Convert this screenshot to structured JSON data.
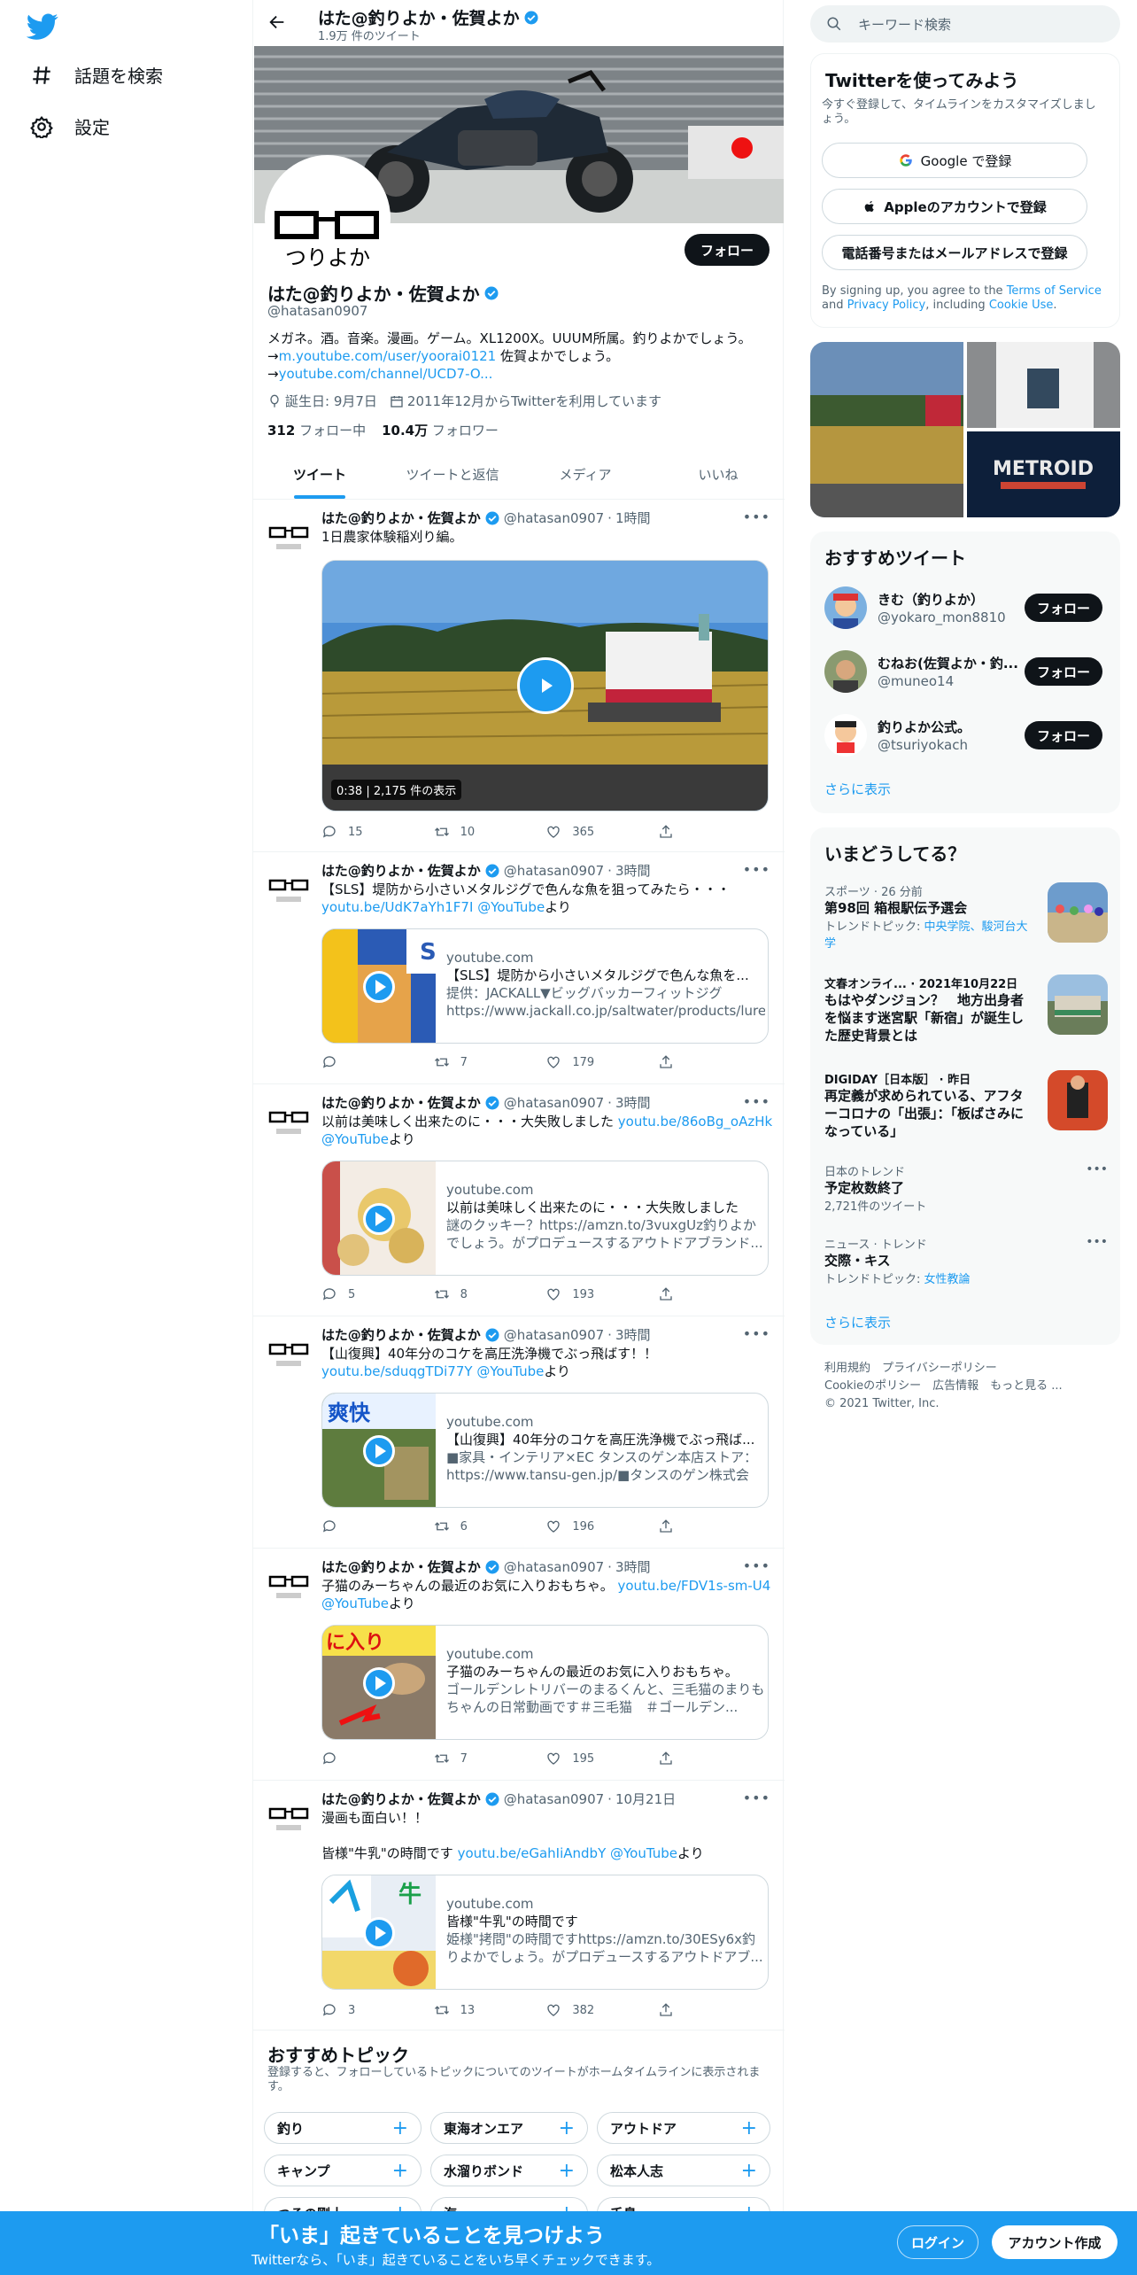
{
  "nav": {
    "explore_label": "話題を検索",
    "settings_label": "設定"
  },
  "profile": {
    "header_name": "はた@釣りよか・佐賀よか",
    "tweet_count": "1.9万 件のツイート",
    "name": "はた@釣りよか・佐賀よか",
    "handle": "@hatasan0907",
    "avatar_text": "つりよか",
    "follow_label": "フォロー",
    "bio_line1": "メガネ。酒。音楽。漫画。ゲーム。XL1200X。UUUM所属。釣りよかでしょう。",
    "bio_arrow": "→",
    "bio_link1": "m.youtube.com/user/yoorai0121",
    "bio_line2_suffix": " 佐賀よかでしょう。",
    "bio_link2": "youtube.com/channel/UCD7-O...",
    "birthday": "誕生日: 9月7日",
    "joined": "2011年12月からTwitterを利用しています",
    "following_count": "312",
    "following_label": "フォロー中",
    "followers_count": "10.4万",
    "followers_label": "フォロワー"
  },
  "tabs": [
    "ツイート",
    "ツイートと返信",
    "メディア",
    "いいね"
  ],
  "tweets": [
    {
      "name": "はた@釣りよか・佐賀よか",
      "handle": "@hatasan0907",
      "time": "1時間",
      "text": "1日農家体験稲刈り編。",
      "video_duration": "0:38",
      "video_views": "2,175 件の表示",
      "replies": "15",
      "retweets": "10",
      "likes": "365"
    },
    {
      "name": "はた@釣りよか・佐賀よか",
      "handle": "@hatasan0907",
      "time": "3時間",
      "text": "【SLS】堤防から小さいメタルジグで色んな魚を狙ってみたら・・・",
      "link": "youtu.be/UdK7aYh1F7I",
      "mention": "@YouTube",
      "suffix": "より",
      "card_domain": "youtube.com",
      "card_title": "【SLS】堤防から小さいメタルジグで色んな魚を...",
      "card_desc": "提供：JACKALL▼ビッグバッカーフィットジグ https://www.jackall.co.jp/saltwater/products/lure/flat-...",
      "replies": "",
      "retweets": "7",
      "likes": "179"
    },
    {
      "name": "はた@釣りよか・佐賀よか",
      "handle": "@hatasan0907",
      "time": "3時間",
      "text": "以前は美味しく出来たのに・・・大失敗しました",
      "link": "youtu.be/86oBg_oAzHk",
      "mention": "@YouTube",
      "suffix": "より",
      "card_domain": "youtube.com",
      "card_title": "以前は美味しく出来たのに・・・大失敗しました",
      "card_desc": "謎のクッキー？https://amzn.to/3vuxgUz釣りよかでしょう。がプロデュースするアウトドアブランド...",
      "replies": "5",
      "retweets": "8",
      "likes": "193"
    },
    {
      "name": "はた@釣りよか・佐賀よか",
      "handle": "@hatasan0907",
      "time": "3時間",
      "text": "【山復興】40年分のコケを高圧洗浄機でぶっ飛ばす！！",
      "link": "youtu.be/sduqgTDi77Y",
      "mention": "@YouTube",
      "suffix": "より",
      "card_domain": "youtube.com",
      "card_title": "【山復興】40年分のコケを高圧洗浄機でぶっ飛ば...",
      "card_desc": "■家具・インテリア×EC タンスのゲン本店ストア：https://www.tansu-gen.jp/■タンスのゲン株式会社：...",
      "replies": "",
      "retweets": "6",
      "likes": "196"
    },
    {
      "name": "はた@釣りよか・佐賀よか",
      "handle": "@hatasan0907",
      "time": "3時間",
      "text": "子猫のみーちゃんの最近のお気に入りおもちゃ。",
      "link": "youtu.be/FDV1s-sm-U4",
      "mention": "@YouTube",
      "suffix": "より",
      "card_domain": "youtube.com",
      "card_title": "子猫のみーちゃんの最近のお気に入りおもちゃ。",
      "card_desc": "ゴールデンレトリバーのまるくんと、三毛猫のまりもちゃんの日常動画です＃三毛猫　＃ゴールデン...",
      "replies": "",
      "retweets": "7",
      "likes": "195"
    },
    {
      "name": "はた@釣りよか・佐賀よか",
      "handle": "@hatasan0907",
      "time": "10月21日",
      "text": "漫画も面白い！！",
      "text2": "皆様\"牛乳\"の時間です",
      "link": "youtu.be/eGahIiAndbY",
      "mention": "@YouTube",
      "suffix": "より",
      "card_domain": "youtube.com",
      "card_title": "皆様\"牛乳\"の時間です",
      "card_desc": "姫様\"拷問\"の時間ですhttps://amzn.to/30ESy6x釣りよかでしょう。がプロデュースするアウトドアブ...",
      "replies": "3",
      "retweets": "13",
      "likes": "382"
    }
  ],
  "topics": {
    "title": "おすすめトピック",
    "subtitle": "登録すると、フォローしているトピックについてのツイートがホームタイムラインに表示されます。",
    "row1": [
      "釣り",
      "東海オンエア",
      "アウトドア"
    ],
    "row2": [
      "キャンプ",
      "水溜りボンド",
      "松本人志"
    ],
    "row3": [
      "つるの剛士",
      "海",
      "千鳥"
    ]
  },
  "sidebar": {
    "search_placeholder": "キーワード検索",
    "signup_title": "Twitterを使ってみよう",
    "signup_sub": "今すぐ登録して、タイムラインをカスタマイズしましょう。",
    "google_btn": "Google で登録",
    "apple_btn": "Appleのアカウントで登録",
    "phone_btn": "電話番号またはメールアドレスで登録",
    "terms_prefix": "By signing up, you agree to the ",
    "terms_link": "Terms of Service",
    "terms_and": " and ",
    "privacy_link": "Privacy Policy",
    "terms_including": ", including ",
    "cookie_link": "Cookie Use",
    "terms_end": ".",
    "media_caption": "METROID",
    "rec_title": "おすすめツイート",
    "recs": [
      {
        "name": "きむ（釣りよか）",
        "handle": "@yokaro_mon8810",
        "btn": "フォロー"
      },
      {
        "name": "むねお(佐賀よか・釣...",
        "handle": "@muneo14",
        "btn": "フォロー"
      },
      {
        "name": "釣りよか公式。",
        "handle": "@tsuriyokach",
        "btn": "フォロー"
      }
    ],
    "show_more": "さらに表示",
    "trend_title": "いまどうしてる？",
    "trends": [
      {
        "meta": "スポーツ · 26 分前",
        "title": "第98回 箱根駅伝予選会",
        "sub_prefix": "トレンドトピック: ",
        "sub_link": "中央学院、駿河台大学"
      },
      {
        "meta": "文春オンライ... · 2021年10月22日",
        "title": "もはやダンジョン？　地方出身者を悩ます迷宮駅「新宿」が誕生した歴史背景とは"
      },
      {
        "meta": "DIGIDAY［日本版］ · 昨日",
        "title": "再定義が求められている、アフターコロナの「出張」：「板ばさみになっている」"
      },
      {
        "meta": "日本のトレンド",
        "title": "予定枚数終了",
        "sub": "2,721件のツイート"
      },
      {
        "meta": "ニュース · トレンド",
        "title": "交際・キス",
        "sub_prefix": "トレンドトピック: ",
        "sub_link": "女性教論"
      }
    ],
    "footer_line1": "利用規約　プライバシーポリシー",
    "footer_line2": "Cookieのポリシー　広告情報　もっと見る ...",
    "footer_line3": "© 2021 Twitter, Inc."
  },
  "bottom": {
    "title": "「いま」起きていることを見つけよう",
    "subtitle": "Twitterなら、「いま」起きていることをいち早くチェックできます。",
    "login": "ログイン",
    "signup": "アカウント作成"
  }
}
